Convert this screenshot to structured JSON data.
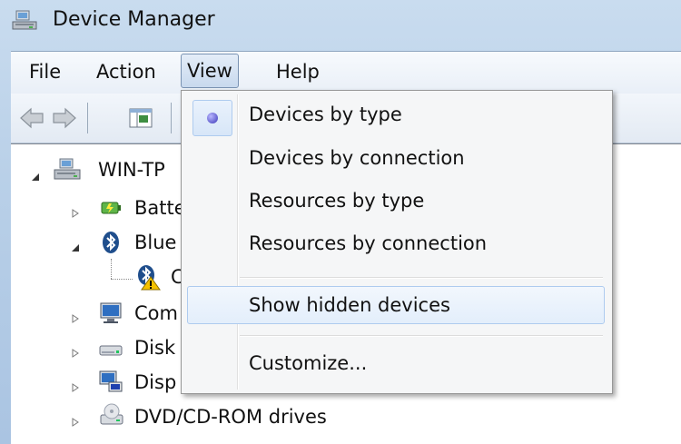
{
  "window": {
    "title": "Device Manager"
  },
  "menubar": {
    "items": [
      "File",
      "Action",
      "View",
      "Help"
    ]
  },
  "tree": {
    "root": "WIN-TP",
    "nodes": [
      {
        "label": "Batte",
        "icon": "battery-icon"
      },
      {
        "label": "Blue",
        "icon": "bluetooth-icon"
      },
      {
        "label": "C",
        "icon": "bluetooth-warning-device-icon"
      },
      {
        "label": "Com",
        "icon": "computer-icon"
      },
      {
        "label": "Disk",
        "icon": "disk-drive-icon"
      },
      {
        "label": "Disp",
        "icon": "display-adapter-icon"
      },
      {
        "label": "DVD/CD-ROM drives",
        "icon": "dvd-drive-icon"
      }
    ]
  },
  "view_menu": {
    "items": [
      {
        "label": "Devices by type",
        "selected": true
      },
      {
        "label": "Devices by connection",
        "selected": false
      },
      {
        "label": "Resources by type",
        "selected": false
      },
      {
        "label": "Resources by connection",
        "selected": false
      },
      {
        "label": "Show hidden devices",
        "selected": false,
        "highlighted": true
      },
      {
        "label": "Customize...",
        "selected": false
      }
    ]
  }
}
